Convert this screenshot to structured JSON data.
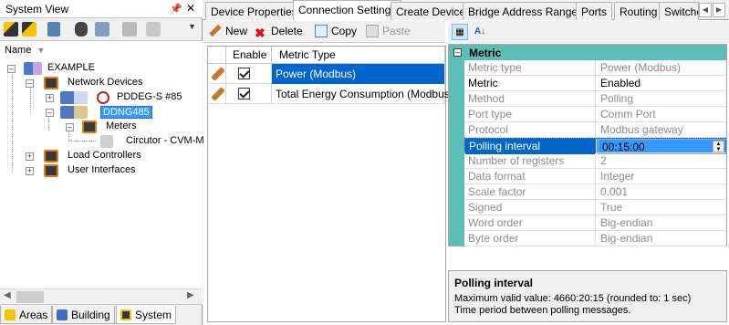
{
  "system_view": {
    "title": "System View",
    "pin_glyph": "‗",
    "close_glyph": "✕",
    "tree_header": "Name",
    "tree": {
      "root": "EXAMPLE",
      "network_devices": "Network Devices",
      "device1": "PDDEG-S #85",
      "device2": "DDNG485",
      "meters": "Meters",
      "meter1": "Circutor - CVM-M",
      "load_controllers": "Load Controllers",
      "user_interfaces": "User Interfaces"
    },
    "bottom_tabs": [
      "Areas",
      "Building",
      "System"
    ],
    "active_bottom_tab": "System"
  },
  "tabs": [
    "Device Properties",
    "Connection Settings",
    "Create Device",
    "Bridge Address Ranges",
    "Ports",
    "Routing",
    "Switche"
  ],
  "active_tab": "Connection Settings",
  "metrics_toolbar": {
    "new_label": "New",
    "delete_label": "Delete",
    "copy_label": "Copy",
    "paste_label": "Paste"
  },
  "metrics_grid": {
    "columns": [
      "Enable",
      "Metric Type"
    ],
    "rows": [
      {
        "enabled": true,
        "metric_type": "Power (Modbus)",
        "selected": true
      },
      {
        "enabled": true,
        "metric_type": "Total Energy Consumption (Modbus)",
        "selected": false
      }
    ]
  },
  "property_grid": {
    "category": "Metric",
    "rows": [
      {
        "key": "Metric type",
        "value": "Power (Modbus)",
        "enabled": false
      },
      {
        "key": "Metric",
        "value": "Enabled",
        "enabled": true
      },
      {
        "key": "Method",
        "value": "Polling",
        "enabled": false
      },
      {
        "key": "Port type",
        "value": "Comm Port",
        "enabled": false
      },
      {
        "key": "Protocol",
        "value": "Modbus gateway",
        "enabled": false
      },
      {
        "key": "Polling interval",
        "value": "00:15:00",
        "enabled": true
      },
      {
        "key": "Number of registers",
        "value": "2",
        "enabled": false
      },
      {
        "key": "Data format",
        "value": "Integer",
        "enabled": false
      },
      {
        "key": "Scale factor",
        "value": "0.001",
        "enabled": false
      },
      {
        "key": "Signed",
        "value": "True",
        "enabled": false
      },
      {
        "key": "Word order",
        "value": "Big-endian",
        "enabled": false
      },
      {
        "key": "Byte order",
        "value": "Big-endian",
        "enabled": false
      }
    ],
    "selected_row": "Polling interval"
  },
  "description": {
    "title": "Polling interval",
    "line1": "Maximum valid value: 4660:20:15 (rounded to: 1 sec)",
    "line2": "Time period between polling messages."
  },
  "colors": {
    "selection": "#0066cc",
    "category_band": "#5cbeb6",
    "tree_selection": "#3399ff"
  }
}
